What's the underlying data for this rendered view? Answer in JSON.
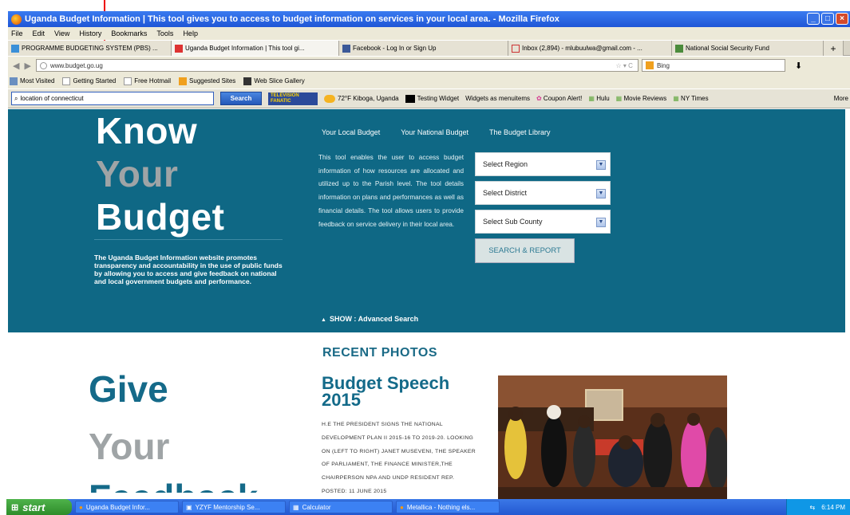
{
  "window": {
    "title": "Uganda Budget Information | This tool gives you to access to budget information on services in your local area. - Mozilla Firefox"
  },
  "menu": [
    "File",
    "Edit",
    "View",
    "History",
    "Bookmarks",
    "Tools",
    "Help"
  ],
  "tabs": [
    {
      "label": "PROGRAMME BUDGETING SYSTEM (PBS) ...",
      "active": false
    },
    {
      "label": "Uganda Budget Information | This tool gi...",
      "active": true
    },
    {
      "label": "Facebook - Log In or Sign Up",
      "active": false
    },
    {
      "label": "Inbox (2,894) - mlubuulwa@gmail.com - ...",
      "active": false
    },
    {
      "label": "National Social Security Fund",
      "active": false
    }
  ],
  "nav": {
    "url": "www.budget.go.ug",
    "search_engine": "Bing"
  },
  "bookmarks": [
    "Most Visited",
    "Getting Started",
    "Free Hotmail",
    "Suggested Sites",
    "Web Slice Gallery"
  ],
  "toolbar": {
    "search_value": "location of connecticut",
    "search_button": "Search",
    "tv_label": "TELEVISION FANATIC",
    "weather": "72°F Kiboga, Uganda",
    "items": [
      "Testing Widget",
      "Widgets as menuitems",
      "Coupon Alert!",
      "Hulu",
      "Movie Reviews",
      "NY Times"
    ],
    "more": "More"
  },
  "hero": {
    "know": "Know",
    "your": "Your",
    "budget": "Budget",
    "description": "The Uganda Budget Information website promotes transparency and accountability in the use of public funds by allowing you to access and give feedback on national and local government budgets and performance.",
    "nav": [
      "Your Local Budget",
      "Your National Budget",
      "The Budget Library"
    ],
    "intro": "This tool enables the user to access budget information of how resources are allocated and utilized up to the Parish level. The tool details information on plans and performances as well as financial details. The tool allows users to provide feedback on service delivery in their local area.",
    "selects": [
      "Select Region",
      "Select District",
      "Select Sub County"
    ],
    "search_report": "SEARCH & REPORT",
    "advanced": "SHOW : Advanced Search"
  },
  "feedback": {
    "give": "Give",
    "your": "Your",
    "feedback": "Feedback"
  },
  "recent": {
    "heading": "RECENT PHOTOS",
    "title": "Budget Speech 2015",
    "description": "H.E THE PRESIDENT SIGNS THE NATIONAL DEVELOPMENT PLAN II 2015-16 TO 2019-20. LOOKING ON (LEFT TO RIGHT) JANET MUSEVENI, THE SPEAKER OF PARLIAMENT, THE FINANCE MINISTER,THE CHAIRPERSON NPA AND UNDP RESIDENT REP. POSTED: 11 JUNE 2015"
  },
  "taskbar": {
    "start": "start",
    "tasks": [
      "Uganda Budget Infor...",
      "YZYF Mentorship Se...",
      "Calculator",
      "Metallica - Nothing els..."
    ],
    "clock": "6:14 PM"
  }
}
